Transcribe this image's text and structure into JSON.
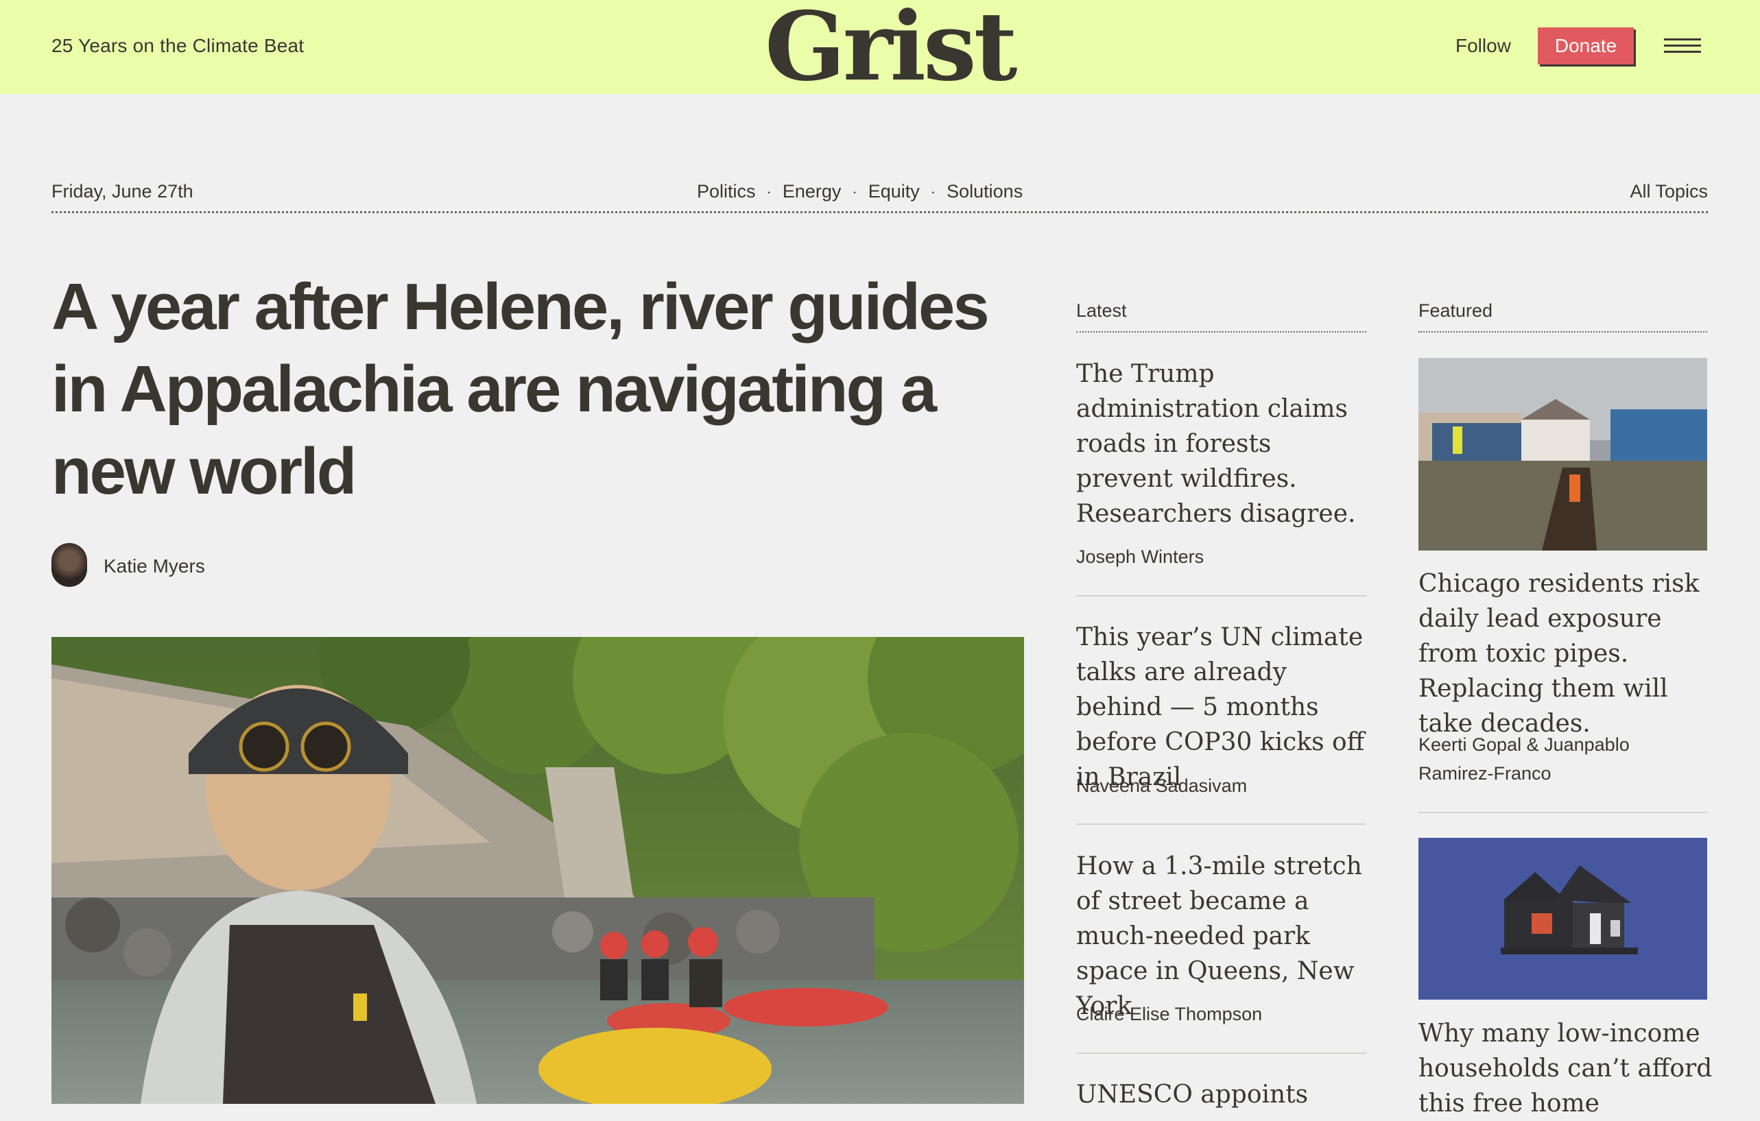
{
  "header": {
    "tagline": "25 Years on the Climate Beat",
    "logo": "Grist",
    "follow": "Follow",
    "donate": "Donate",
    "menu_icon": "hamburger-menu-icon",
    "background": "#eafea9",
    "donate_color": "#e05a5f"
  },
  "nav": {
    "date": "Friday, June 27th",
    "topics": [
      "Politics",
      "Energy",
      "Equity",
      "Solutions"
    ],
    "separator": "·",
    "all_topics": "All Topics"
  },
  "hero": {
    "headline": "A year after Helene, river guides in Appalachia are navigating a new world",
    "author": "Katie Myers"
  },
  "latest": {
    "heading": "Latest",
    "stories": [
      {
        "title": "The Trump administration claims roads in forests prevent wildfires. Researchers disagree.",
        "author": "Joseph Winters"
      },
      {
        "title": "This year’s UN climate talks are already behind — 5 months before COP30 kicks off in Brazil",
        "author": "Naveena Sadasivam"
      },
      {
        "title": "How a 1.3-mile stretch of street became a much-needed park space in Queens, New York",
        "author": "Claire Elise Thompson"
      },
      {
        "title": "UNESCO appoints",
        "author": ""
      }
    ]
  },
  "featured": {
    "heading": "Featured",
    "stories": [
      {
        "title": "Chicago residents risk daily lead exposure from toxic pipes. Replacing them will take decades.",
        "author": "Keerti Gopal & Juanpablo Ramirez-Franco"
      },
      {
        "title": "Why many low-income households can’t afford this free home",
        "author": ""
      }
    ]
  }
}
